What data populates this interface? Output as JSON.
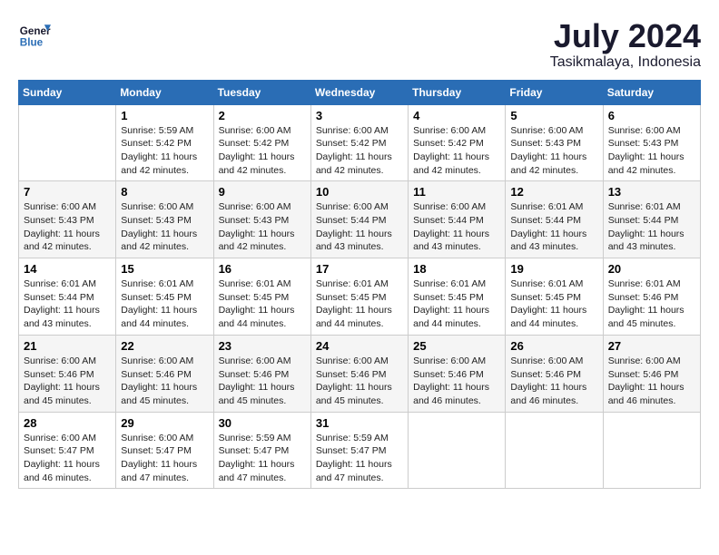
{
  "header": {
    "logo_line1": "General",
    "logo_line2": "Blue",
    "title": "July 2024",
    "subtitle": "Tasikmalaya, Indonesia"
  },
  "days_of_week": [
    "Sunday",
    "Monday",
    "Tuesday",
    "Wednesday",
    "Thursday",
    "Friday",
    "Saturday"
  ],
  "weeks": [
    [
      {
        "day": "",
        "content": ""
      },
      {
        "day": "1",
        "content": "Sunrise: 5:59 AM\nSunset: 5:42 PM\nDaylight: 11 hours\nand 42 minutes."
      },
      {
        "day": "2",
        "content": "Sunrise: 6:00 AM\nSunset: 5:42 PM\nDaylight: 11 hours\nand 42 minutes."
      },
      {
        "day": "3",
        "content": "Sunrise: 6:00 AM\nSunset: 5:42 PM\nDaylight: 11 hours\nand 42 minutes."
      },
      {
        "day": "4",
        "content": "Sunrise: 6:00 AM\nSunset: 5:42 PM\nDaylight: 11 hours\nand 42 minutes."
      },
      {
        "day": "5",
        "content": "Sunrise: 6:00 AM\nSunset: 5:43 PM\nDaylight: 11 hours\nand 42 minutes."
      },
      {
        "day": "6",
        "content": "Sunrise: 6:00 AM\nSunset: 5:43 PM\nDaylight: 11 hours\nand 42 minutes."
      }
    ],
    [
      {
        "day": "7",
        "content": "Sunrise: 6:00 AM\nSunset: 5:43 PM\nDaylight: 11 hours\nand 42 minutes."
      },
      {
        "day": "8",
        "content": "Sunrise: 6:00 AM\nSunset: 5:43 PM\nDaylight: 11 hours\nand 42 minutes."
      },
      {
        "day": "9",
        "content": "Sunrise: 6:00 AM\nSunset: 5:43 PM\nDaylight: 11 hours\nand 42 minutes."
      },
      {
        "day": "10",
        "content": "Sunrise: 6:00 AM\nSunset: 5:44 PM\nDaylight: 11 hours\nand 43 minutes."
      },
      {
        "day": "11",
        "content": "Sunrise: 6:00 AM\nSunset: 5:44 PM\nDaylight: 11 hours\nand 43 minutes."
      },
      {
        "day": "12",
        "content": "Sunrise: 6:01 AM\nSunset: 5:44 PM\nDaylight: 11 hours\nand 43 minutes."
      },
      {
        "day": "13",
        "content": "Sunrise: 6:01 AM\nSunset: 5:44 PM\nDaylight: 11 hours\nand 43 minutes."
      }
    ],
    [
      {
        "day": "14",
        "content": "Sunrise: 6:01 AM\nSunset: 5:44 PM\nDaylight: 11 hours\nand 43 minutes."
      },
      {
        "day": "15",
        "content": "Sunrise: 6:01 AM\nSunset: 5:45 PM\nDaylight: 11 hours\nand 44 minutes."
      },
      {
        "day": "16",
        "content": "Sunrise: 6:01 AM\nSunset: 5:45 PM\nDaylight: 11 hours\nand 44 minutes."
      },
      {
        "day": "17",
        "content": "Sunrise: 6:01 AM\nSunset: 5:45 PM\nDaylight: 11 hours\nand 44 minutes."
      },
      {
        "day": "18",
        "content": "Sunrise: 6:01 AM\nSunset: 5:45 PM\nDaylight: 11 hours\nand 44 minutes."
      },
      {
        "day": "19",
        "content": "Sunrise: 6:01 AM\nSunset: 5:45 PM\nDaylight: 11 hours\nand 44 minutes."
      },
      {
        "day": "20",
        "content": "Sunrise: 6:01 AM\nSunset: 5:46 PM\nDaylight: 11 hours\nand 45 minutes."
      }
    ],
    [
      {
        "day": "21",
        "content": "Sunrise: 6:00 AM\nSunset: 5:46 PM\nDaylight: 11 hours\nand 45 minutes."
      },
      {
        "day": "22",
        "content": "Sunrise: 6:00 AM\nSunset: 5:46 PM\nDaylight: 11 hours\nand 45 minutes."
      },
      {
        "day": "23",
        "content": "Sunrise: 6:00 AM\nSunset: 5:46 PM\nDaylight: 11 hours\nand 45 minutes."
      },
      {
        "day": "24",
        "content": "Sunrise: 6:00 AM\nSunset: 5:46 PM\nDaylight: 11 hours\nand 45 minutes."
      },
      {
        "day": "25",
        "content": "Sunrise: 6:00 AM\nSunset: 5:46 PM\nDaylight: 11 hours\nand 46 minutes."
      },
      {
        "day": "26",
        "content": "Sunrise: 6:00 AM\nSunset: 5:46 PM\nDaylight: 11 hours\nand 46 minutes."
      },
      {
        "day": "27",
        "content": "Sunrise: 6:00 AM\nSunset: 5:46 PM\nDaylight: 11 hours\nand 46 minutes."
      }
    ],
    [
      {
        "day": "28",
        "content": "Sunrise: 6:00 AM\nSunset: 5:47 PM\nDaylight: 11 hours\nand 46 minutes."
      },
      {
        "day": "29",
        "content": "Sunrise: 6:00 AM\nSunset: 5:47 PM\nDaylight: 11 hours\nand 47 minutes."
      },
      {
        "day": "30",
        "content": "Sunrise: 5:59 AM\nSunset: 5:47 PM\nDaylight: 11 hours\nand 47 minutes."
      },
      {
        "day": "31",
        "content": "Sunrise: 5:59 AM\nSunset: 5:47 PM\nDaylight: 11 hours\nand 47 minutes."
      },
      {
        "day": "",
        "content": ""
      },
      {
        "day": "",
        "content": ""
      },
      {
        "day": "",
        "content": ""
      }
    ]
  ]
}
